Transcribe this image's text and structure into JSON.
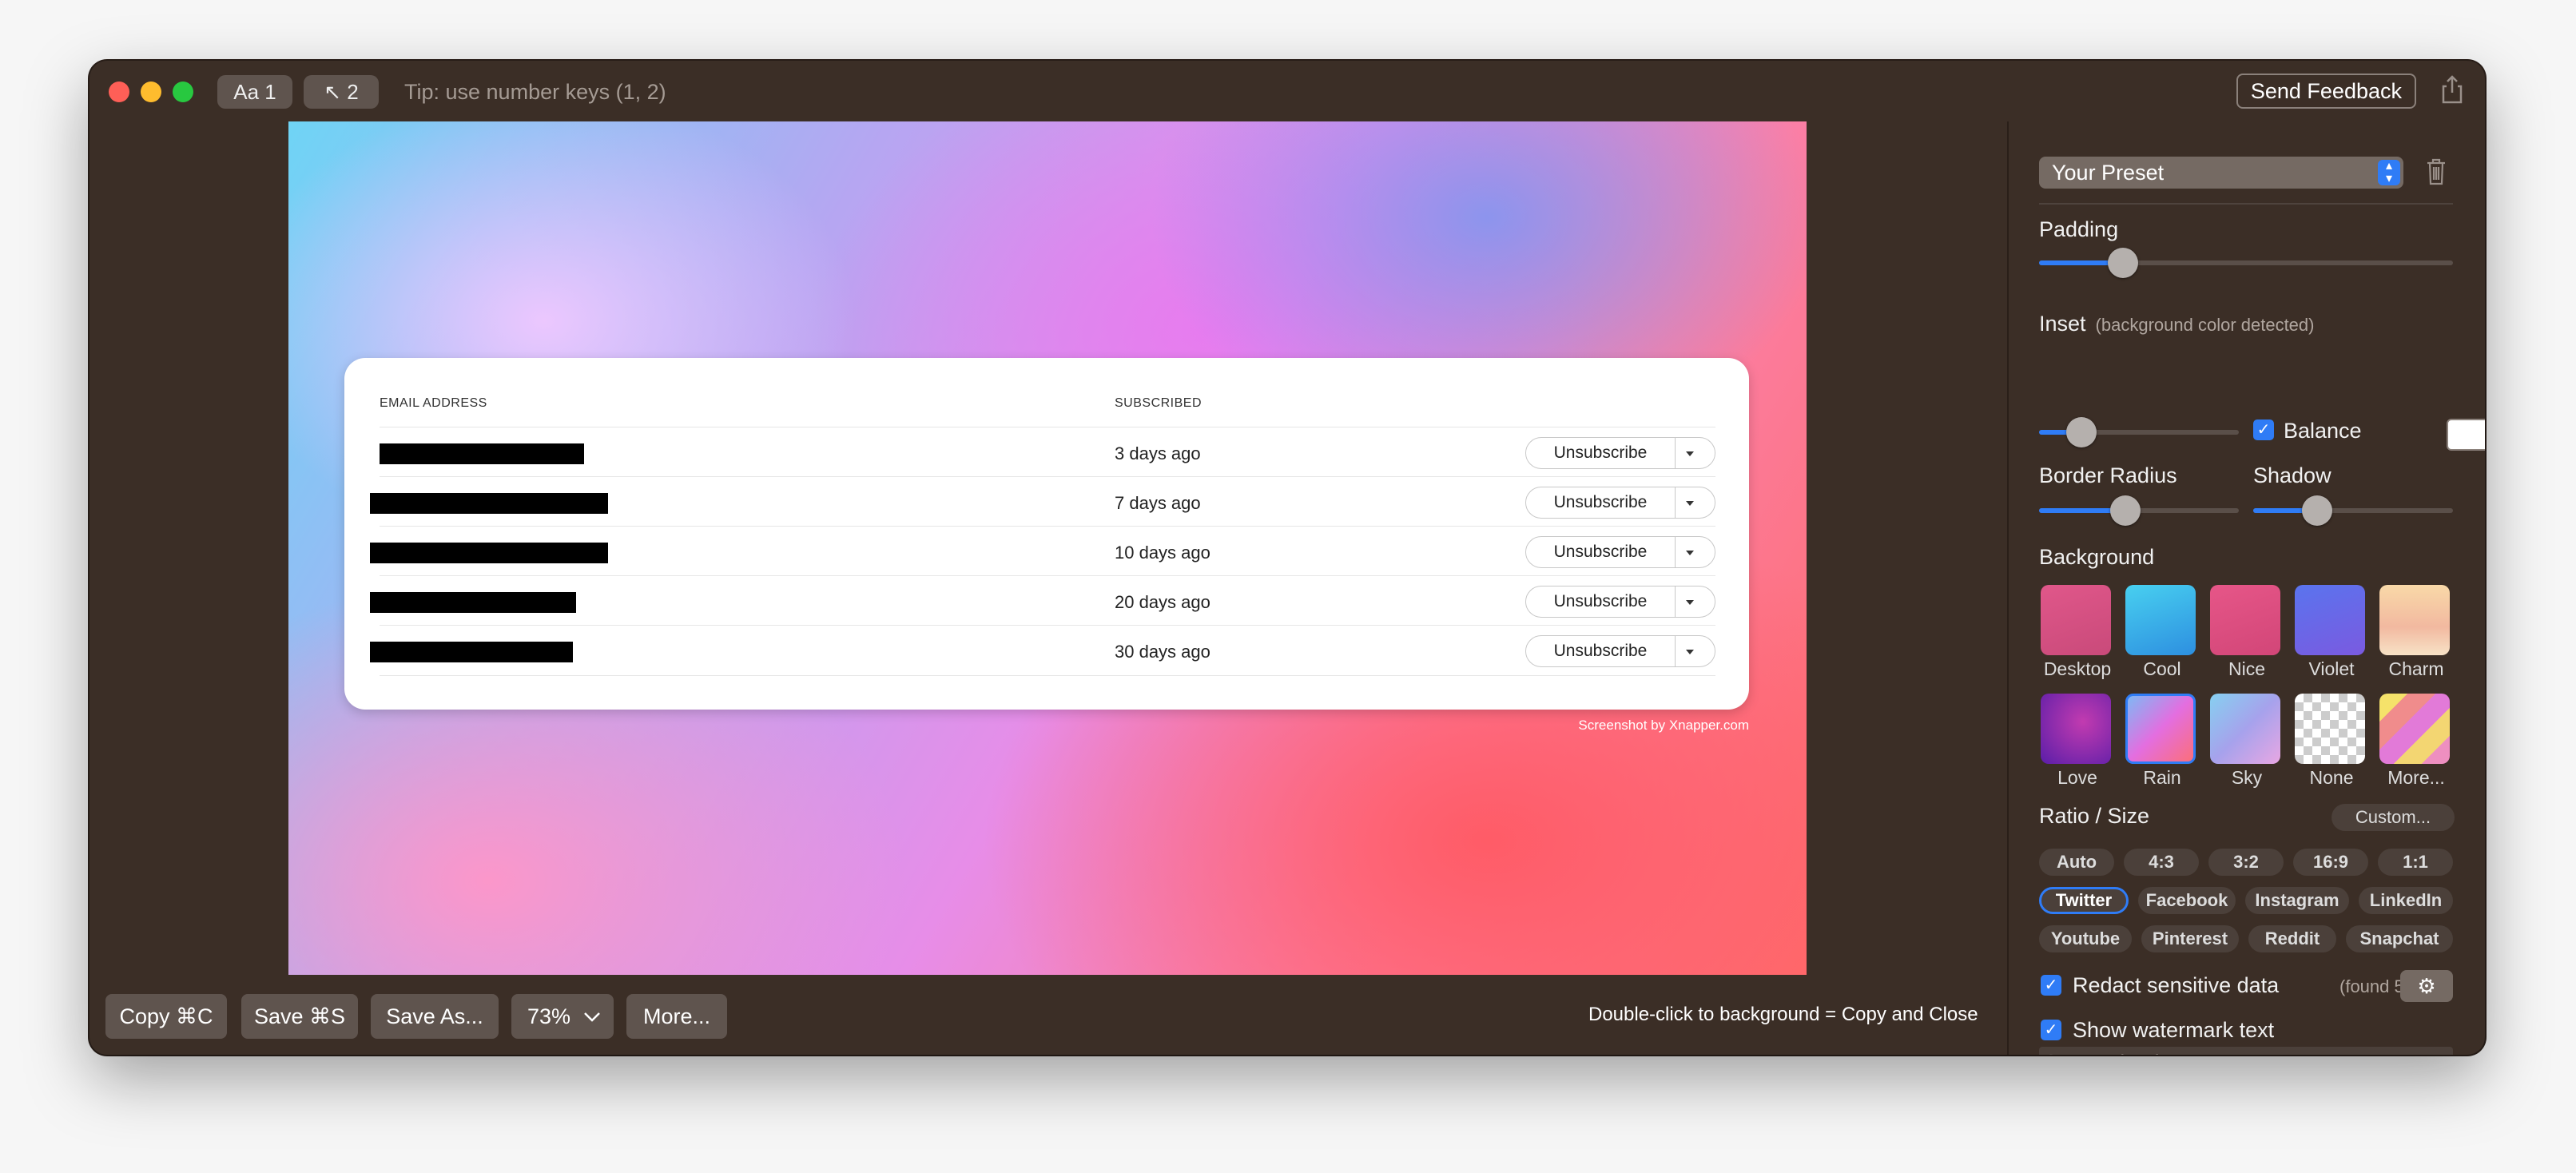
{
  "toolbar": {
    "text_mode": "Aa 1",
    "arrow_mode": "↖ 2",
    "tip": "Tip: use number keys (1, 2)",
    "send_feedback": "Send Feedback"
  },
  "canvas": {
    "table": {
      "headers": [
        "EMAIL ADDRESS",
        "SUBSCRIBED"
      ],
      "rows": [
        {
          "subscribed": "3 days ago",
          "action": "Unsubscribe"
        },
        {
          "subscribed": "7 days ago",
          "action": "Unsubscribe"
        },
        {
          "subscribed": "10 days ago",
          "action": "Unsubscribe"
        },
        {
          "subscribed": "20 days ago",
          "action": "Unsubscribe"
        },
        {
          "subscribed": "30 days ago",
          "action": "Unsubscribe"
        }
      ]
    },
    "watermark": "Screenshot by Xnapper.com"
  },
  "bottom": {
    "copy": "Copy ⌘C",
    "save": "Save ⌘S",
    "save_as": "Save As...",
    "zoom": "73%",
    "more": "More...",
    "hint": "Double-click to background = Copy and Close"
  },
  "panel": {
    "preset": "Your Preset",
    "padding_label": "Padding",
    "padding_value": 0.18,
    "inset_label": "Inset",
    "inset_note": "(background color detected)",
    "inset_value": 0.16,
    "balance_label": "Balance",
    "balance_checked": true,
    "border_radius_label": "Border Radius",
    "border_radius_value": 0.42,
    "shadow_label": "Shadow",
    "shadow_value": 0.29,
    "background_label": "Background",
    "backgrounds": [
      {
        "label": "Desktop",
        "color": "#d94f84"
      },
      {
        "label": "Cool",
        "color": "#38b6ec"
      },
      {
        "label": "Nice",
        "color": "#e04f80"
      },
      {
        "label": "Violet",
        "color": "#6c6be8"
      },
      {
        "label": "Charm",
        "color": "#f6cfa0"
      },
      {
        "label": "Love",
        "color": "#7a2bbd"
      },
      {
        "label": "Rain",
        "color": "#e86ad7"
      },
      {
        "label": "Sky",
        "color": "#96c3ee"
      },
      {
        "label": "None",
        "color": "#cccccc"
      },
      {
        "label": "More...",
        "color": "#f2c65a"
      }
    ],
    "ratio_label": "Ratio / Size",
    "custom": "Custom...",
    "ratios": [
      "Auto",
      "4:3",
      "3:2",
      "16:9",
      "1:1"
    ],
    "sizes_row1": [
      "Twitter",
      "Facebook",
      "Instagram",
      "LinkedIn"
    ],
    "sizes_row2": [
      "Youtube",
      "Pinterest",
      "Reddit",
      "Snapchat"
    ],
    "selected_size": "Twitter",
    "redact_label": "Redact sensitive data",
    "redact_found": "(found 5)",
    "redact_checked": true,
    "watermark_label": "Show watermark text",
    "watermark_checked": true,
    "watermark_placeholder": "Screenshot by Xnapper.com"
  }
}
